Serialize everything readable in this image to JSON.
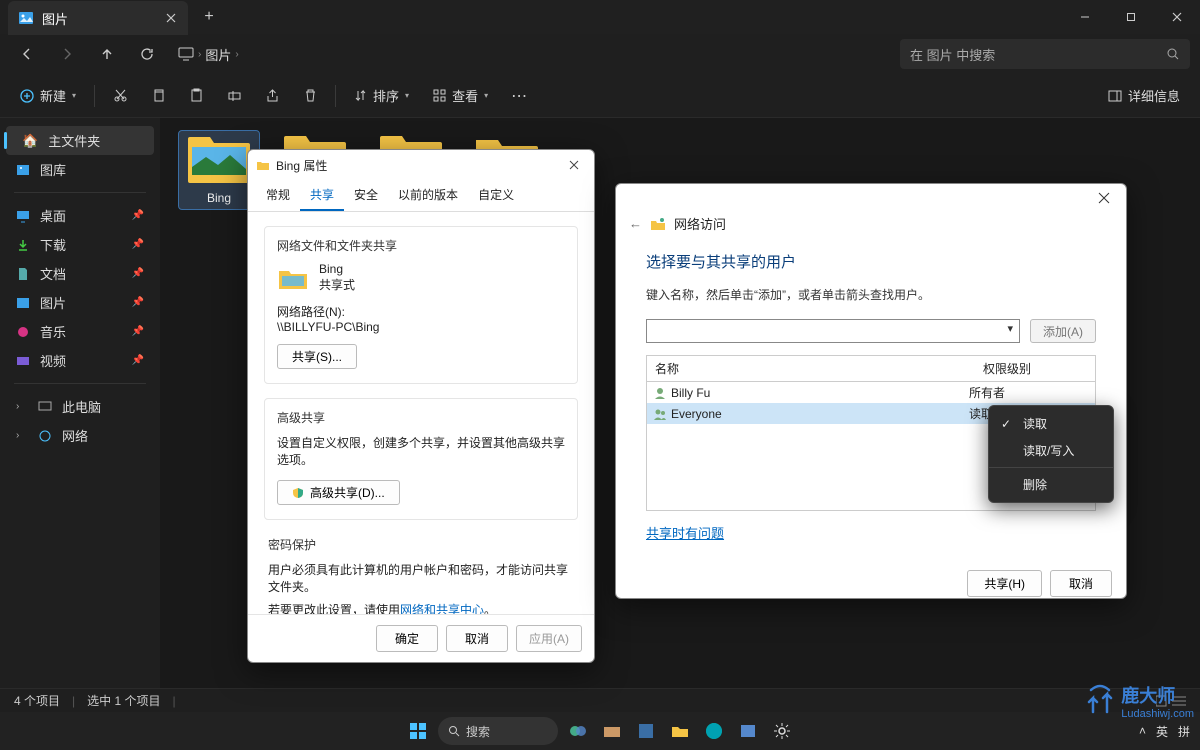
{
  "titlebar": {
    "tab_label": "图片"
  },
  "nav": {
    "breadcrumb": [
      "图片"
    ],
    "search_placeholder": "在 图片 中搜索"
  },
  "toolbar": {
    "new": "新建",
    "sort": "排序",
    "view": "查看",
    "details": "详细信息"
  },
  "sidebar": {
    "home": "主文件夹",
    "gallery": "图库",
    "desktop": "桌面",
    "downloads": "下载",
    "documents": "文档",
    "pictures": "图片",
    "music": "音乐",
    "videos": "视频",
    "thispc": "此电脑",
    "network": "网络"
  },
  "content": {
    "folder_bing": "Bing"
  },
  "status": {
    "count": "4 个项目",
    "selected": "选中 1 个项目"
  },
  "dlg1": {
    "title": "Bing 属性",
    "tabs": {
      "general": "常规",
      "share": "共享",
      "security": "安全",
      "prev": "以前的版本",
      "custom": "自定义"
    },
    "sec1_title": "网络文件和文件夹共享",
    "name": "Bing",
    "shared": "共享式",
    "path_label": "网络路径(N):",
    "path": "\\\\BILLYFU-PC\\Bing",
    "share_btn": "共享(S)...",
    "sec2_title": "高级共享",
    "sec2_desc": "设置自定义权限，创建多个共享，并设置其他高级共享选项。",
    "adv_btn": "高级共享(D)...",
    "sec3_title": "密码保护",
    "sec3_line1": "用户必须具有此计算机的用户帐户和密码，才能访问共享文件夹。",
    "sec3_line2a": "若要更改此设置，请使用",
    "sec3_link": "网络和共享中心",
    "sec3_line2b": "。",
    "ok": "确定",
    "cancel": "取消",
    "apply": "应用(A)"
  },
  "dlg2": {
    "back_title": "网络访问",
    "heading": "选择要与其共享的用户",
    "desc": "键入名称，然后单击“添加”，或者单击箭头查找用户。",
    "add": "添加(A)",
    "col_name": "名称",
    "col_perm": "权限级别",
    "user1": "Billy Fu",
    "perm1": "所有者",
    "user2": "Everyone",
    "perm2": "读取",
    "help": "共享时有问题",
    "share": "共享(H)",
    "cancel": "取消"
  },
  "menu": {
    "read": "读取",
    "rw": "读取/写入",
    "remove": "删除"
  },
  "taskbar": {
    "search": "搜索"
  },
  "tray": {
    "lang1": "英",
    "lang2": "拼"
  },
  "watermark": {
    "text": "鹿大师",
    "url": "Ludashiwj.com"
  }
}
